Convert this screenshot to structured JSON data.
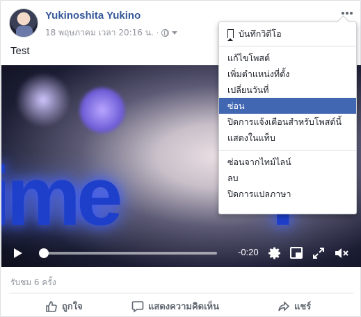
{
  "post": {
    "author": "Yukinoshita Yukino",
    "timestamp": "18 พฤษภาคม เวลา 20:16 น.",
    "separator": "·",
    "privacy_icon": "globe-icon",
    "text": "Test"
  },
  "video": {
    "progress_fraction": 0.02,
    "time_remaining": "-0:20",
    "controls": [
      "play-icon",
      "settings-icon",
      "pip-icon",
      "fullscreen-icon",
      "mute-icon"
    ]
  },
  "menu": {
    "save_video": "บันทึกวิดีโอ",
    "edit_post": "แก้ไขโพสต์",
    "add_location": "เพิ่มตำแหน่งที่ตั้ง",
    "change_date": "เปลี่ยนวันที่",
    "hide": "ซ่อน",
    "turn_off_notifications": "ปิดการแจ้งเตือนสำหรับโพสต์นี้",
    "show_in_tab": "แสดงในแท็บ",
    "hide_from_timeline": "ซ่อนจากไทม์ไลน์",
    "delete": "ลบ",
    "turn_off_translation": "ปิดการแปลภาษา"
  },
  "stats": {
    "views": "รับชม 6 ครั้ง"
  },
  "actions": {
    "like": "ถูกใจ",
    "comment": "แสดงความคิดเห็น",
    "share": "แชร์"
  },
  "colors": {
    "link": "#365899",
    "menu_selected": "#4267b2",
    "secondary_text": "#90949c"
  }
}
